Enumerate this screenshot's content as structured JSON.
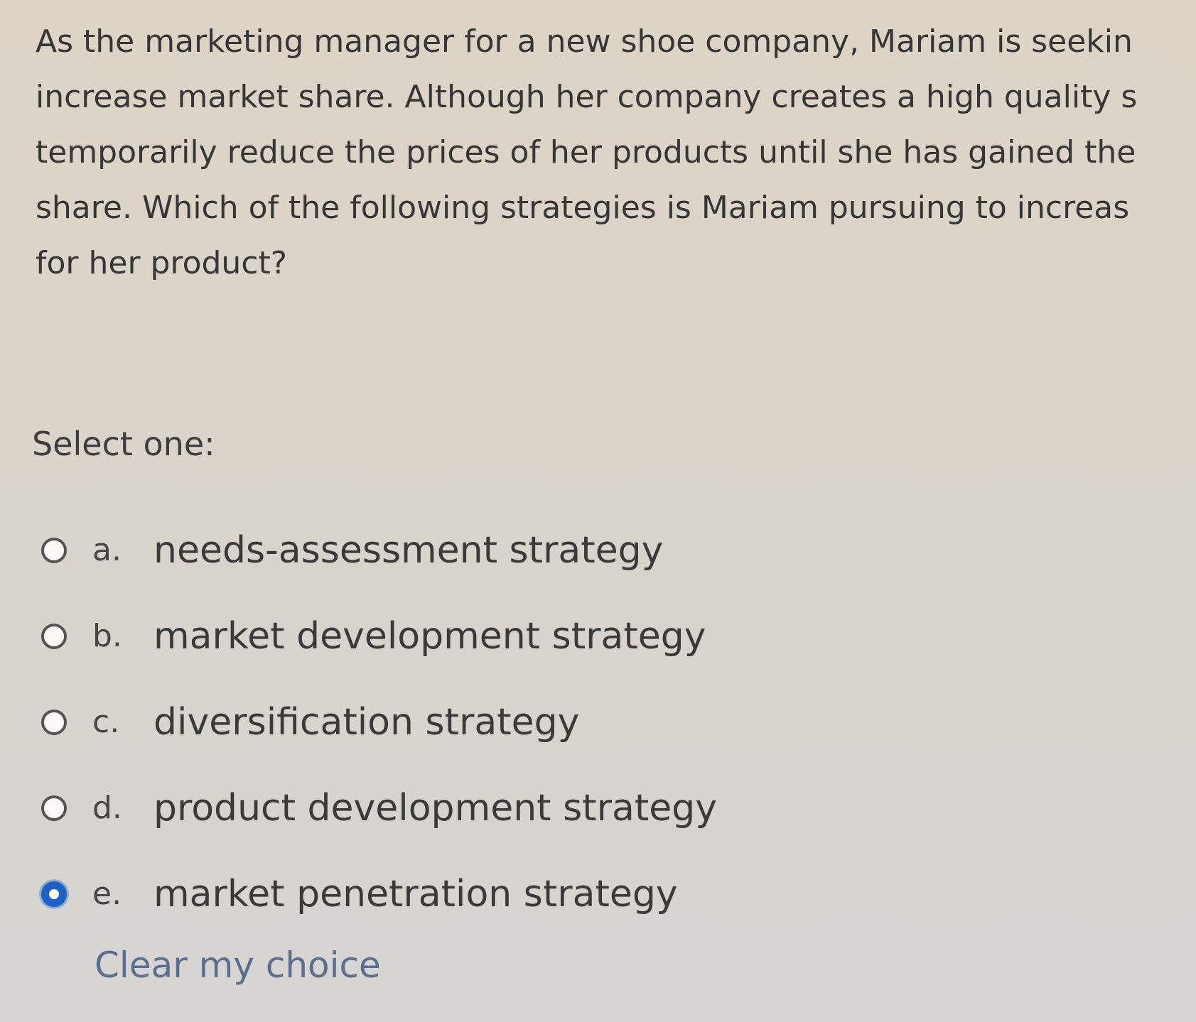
{
  "question": {
    "lines": [
      "As the marketing manager for a new shoe company, Mariam is seekin",
      "increase market share. Although her company creates a high quality s",
      "temporarily reduce the prices of her products until she has gained the",
      "share. Which of the following strategies is Mariam pursuing to increas",
      "for her product?"
    ]
  },
  "prompt": "Select one:",
  "options": [
    {
      "letter": "a.",
      "text": "needs-assessment strategy",
      "selected": false
    },
    {
      "letter": "b.",
      "text": "market development strategy",
      "selected": false
    },
    {
      "letter": "c.",
      "text": "diversification strategy",
      "selected": false
    },
    {
      "letter": "d.",
      "text": "product development strategy",
      "selected": false
    },
    {
      "letter": "e.",
      "text": "market penetration strategy",
      "selected": true
    }
  ],
  "clear_choice": "Clear my choice",
  "colors": {
    "selected_radio": "#1a62c7",
    "link": "#5b6e8e"
  }
}
